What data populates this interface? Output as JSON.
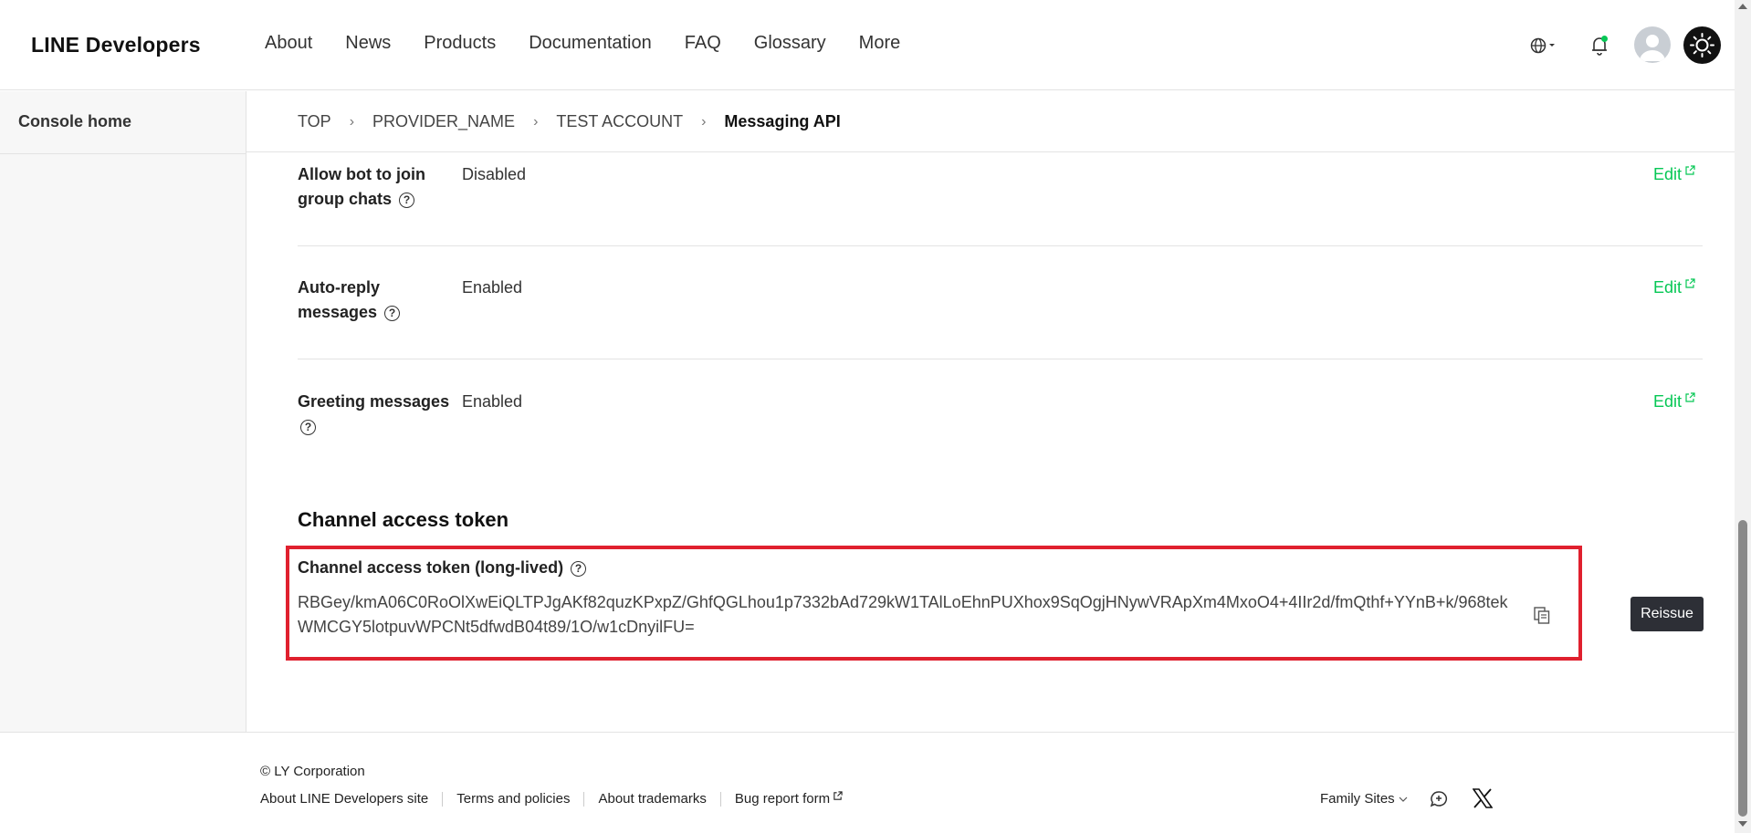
{
  "header": {
    "logo": "LINE Developers",
    "nav": [
      "About",
      "News",
      "Products",
      "Documentation",
      "FAQ",
      "Glossary",
      "More"
    ]
  },
  "sidebar": {
    "home": "Console home"
  },
  "breadcrumb": {
    "items": [
      "TOP",
      "PROVIDER_NAME",
      "TEST ACCOUNT"
    ],
    "current": "Messaging API"
  },
  "settings": [
    {
      "label": "Allow bot to join group chats",
      "value": "Disabled",
      "edit": "Edit"
    },
    {
      "label": "Auto-reply messages",
      "value": "Enabled",
      "edit": "Edit"
    },
    {
      "label": "Greeting messages",
      "value": "Enabled",
      "edit": "Edit"
    }
  ],
  "token": {
    "section_title": "Channel access token",
    "label": "Channel access token (long-lived)",
    "value": "RBGey/kmA06C0RoOlXwEiQLTPJgAKf82quzKPxpZ/GhfQGLhou1p7332bAd729kW1TAlLoEhnPUXhox9SqOgjHNywVRApXm4MxoO4+4IIr2d/fmQthf+YYnB+k/968tekWMCGY5lotpuvWPCNt5dfwdB04t89/1O/w1cDnyilFU=",
    "reissue": "Reissue"
  },
  "footer": {
    "copyright": "© LY Corporation",
    "links": [
      "About LINE Developers site",
      "Terms and policies",
      "About trademarks",
      "Bug report form"
    ],
    "family_sites": "Family Sites"
  },
  "colors": {
    "accent_green": "#06c755",
    "highlight_red": "#e0202e",
    "button_dark": "#2d2f36"
  }
}
